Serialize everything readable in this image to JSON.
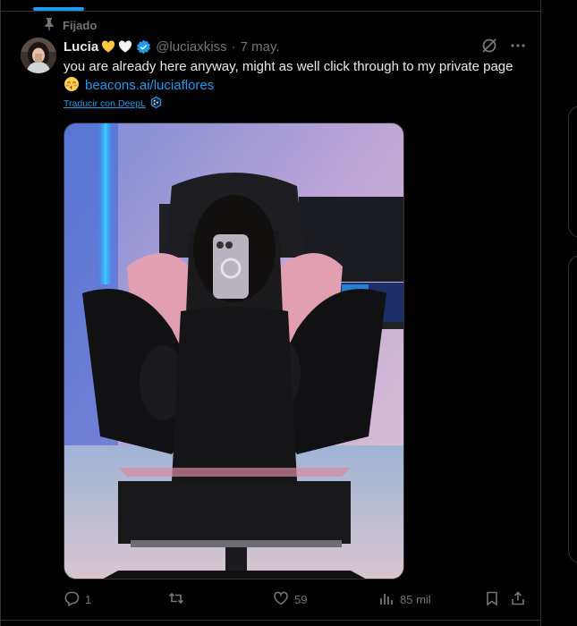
{
  "pinned": {
    "label": "Fijado"
  },
  "author": {
    "display_name": "Lucia",
    "handle": "@luciaxkiss",
    "separator": "·",
    "date": "7 may."
  },
  "tweet": {
    "text": "you are already here anyway, might as well click through to my private page",
    "link_text": "beacons.ai/luciaflores",
    "translate_label": "Traducir con DeepL"
  },
  "stats": {
    "replies": "1",
    "reposts": "",
    "likes": "59",
    "views": "85 mil"
  },
  "icons": {
    "pinned": "pin-icon",
    "verified": "verified-badge-icon",
    "grok": "grok-icon",
    "more": "more-icon",
    "deepl": "deepl-icon",
    "reply": "reply-icon",
    "repost": "repost-icon",
    "like": "heart-icon",
    "views": "analytics-icon",
    "bookmark": "bookmark-icon",
    "share": "share-icon"
  },
  "colors": {
    "background": "#000000",
    "text_primary": "#e7e9ea",
    "text_secondary": "#71767b",
    "accent": "#1d9bf0",
    "border": "#2f3336"
  }
}
